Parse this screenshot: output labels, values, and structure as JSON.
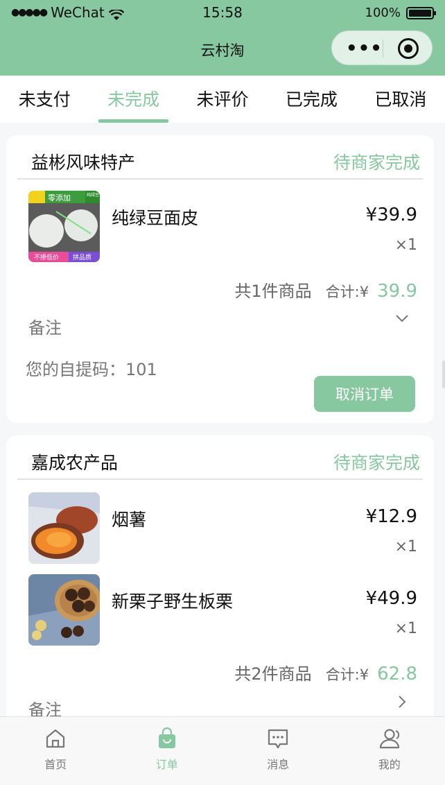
{
  "status_bar": {
    "carrier": "WeChat",
    "time": "15:58",
    "battery": "100%"
  },
  "nav": {
    "title": "云村淘"
  },
  "tabs": [
    {
      "label": "未支付",
      "active": false
    },
    {
      "label": "未完成",
      "active": true
    },
    {
      "label": "未评价",
      "active": false
    },
    {
      "label": "已完成",
      "active": false
    },
    {
      "label": "已取消",
      "active": false
    }
  ],
  "orders": [
    {
      "shop": "益彬风味特产",
      "status": "待商家完成",
      "items": [
        {
          "name": "纯绿豆面皮",
          "price": "¥39.9",
          "qty": "×1",
          "thumb_text": [
            "零添加",
            "纯绿豆",
            "不掺低价",
            "拼品质"
          ]
        }
      ],
      "count_text": "共1件商品",
      "total_label": "合计:¥",
      "total": "39.9",
      "note_label": "备注",
      "pickup_text": "您的自提码：101",
      "cancel_label": "取消订单"
    },
    {
      "shop": "嘉成农产品",
      "status": "待商家完成",
      "items": [
        {
          "name": "烟薯",
          "price": "¥12.9",
          "qty": "×1"
        },
        {
          "name": "新栗子野生板栗",
          "price": "¥49.9",
          "qty": "×1"
        }
      ],
      "count_text": "共2件商品",
      "total_label": "合计:¥",
      "total": "62.8",
      "note_label": "备注"
    }
  ],
  "tabbar": [
    {
      "label": "首页",
      "icon": "home-icon",
      "active": false
    },
    {
      "label": "订单",
      "icon": "bag-icon",
      "active": true
    },
    {
      "label": "消息",
      "icon": "message-icon",
      "active": false
    },
    {
      "label": "我的",
      "icon": "user-icon",
      "active": false
    }
  ],
  "colors": {
    "accent": "#87c8a0",
    "background": "#f6f7f9"
  }
}
